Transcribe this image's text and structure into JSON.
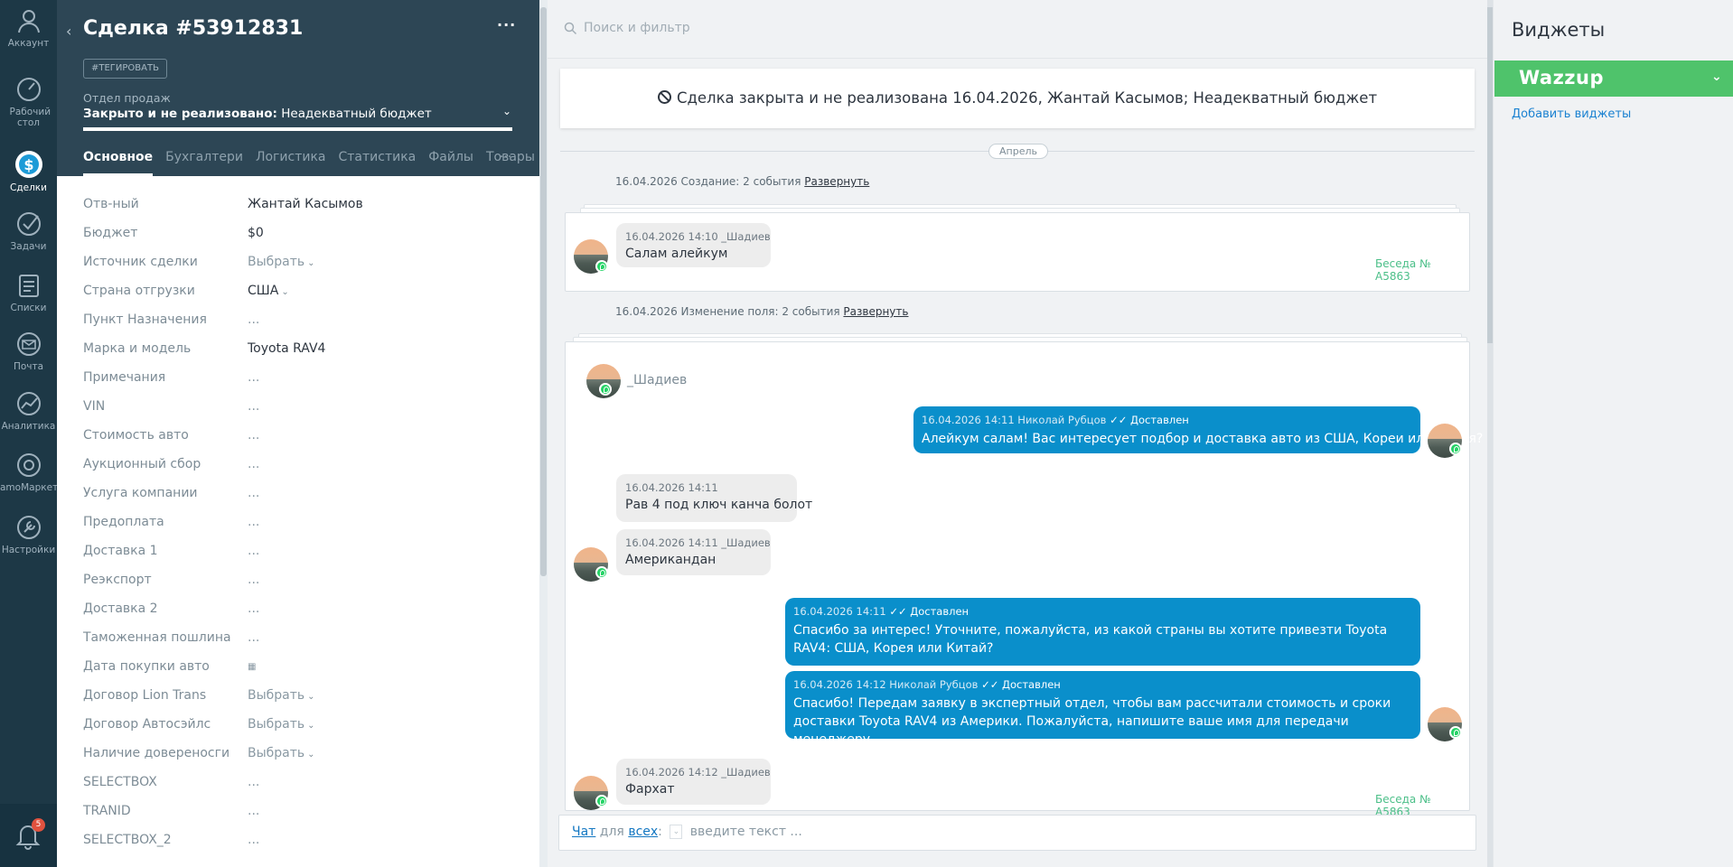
{
  "nav": {
    "account": "Аккаунт",
    "dashboard": "Рабочий стол",
    "deals": "Сделки",
    "tasks": "Задачи",
    "lists": "Списки",
    "mail": "Почта",
    "analytics": "Аналитика",
    "market": "amoМаркет",
    "settings": "Настройки",
    "notifications_count": "5"
  },
  "card": {
    "title": "Сделка #53912831",
    "tag_button": "#ТЕГИРОВАТЬ",
    "pipeline_label": "Отдел продаж",
    "status_prefix": "Закрыто и не реализовано:",
    "status_reason": "Неадекватный бюджет",
    "more": "···",
    "tabs": [
      "Основное",
      "Бухгалтери",
      "Логистика",
      "Статистика",
      "Файлы",
      "Товары"
    ],
    "tabs_more": "···",
    "fields": [
      {
        "label": "Отв-ный",
        "value": "Жантай Касымов"
      },
      {
        "label": "Бюджет",
        "value": "$0"
      },
      {
        "label": "Источник сделки",
        "value": "Выбрать"
      },
      {
        "label": "Страна отгрузки",
        "value": "США"
      },
      {
        "label": "Пункт Назначения",
        "value": "..."
      },
      {
        "label": "Марка и модель",
        "value": "Toyota RAV4"
      },
      {
        "label": "Примечания",
        "value": "..."
      },
      {
        "label": "VIN",
        "value": "..."
      },
      {
        "label": "Стоимость авто",
        "value": "..."
      },
      {
        "label": "Аукционный сбор",
        "value": "..."
      },
      {
        "label": "Услуга компании",
        "value": "..."
      },
      {
        "label": "Предоплата",
        "value": "..."
      },
      {
        "label": "Доставка 1",
        "value": "..."
      },
      {
        "label": "Реэкспорт",
        "value": "..."
      },
      {
        "label": "Доставка 2",
        "value": "..."
      },
      {
        "label": "Таможенная пошлина",
        "value": "..."
      },
      {
        "label": "Дата покупки авто",
        "value": ""
      },
      {
        "label": "Договор Lion Trans",
        "value": "Выбрать"
      },
      {
        "label": "Договор Автосэйлс",
        "value": "Выбрать"
      },
      {
        "label": "Наличие довереносги",
        "value": "Выбрать"
      },
      {
        "label": "SELECTBOX",
        "value": "..."
      },
      {
        "label": "TRANID",
        "value": "..."
      },
      {
        "label": "SELECTBOX_2",
        "value": "..."
      }
    ]
  },
  "feed": {
    "search_placeholder": "Поиск и фильтр",
    "closed_banner": "Сделка закрыта и не реализована 16.04.2026, Жантай Касымов; Неадекватный бюджет",
    "month": "Апрель",
    "event1": "16.04.2026 Создание: 2 события",
    "event2": "16.04.2026 Изменение поля: 2 события",
    "expand": "Развернуть",
    "chat_link": "Беседа № A5863",
    "sender": "_Шадиев",
    "messages": [
      {
        "meta": "16.04.2026 14:10 _Шадиев",
        "text": "Салам алейкум"
      },
      {
        "meta": "16.04.2026 14:11 Николай Рубцов",
        "status": "Доставлен",
        "text": "Алейкум салам! Вас интересует подбор и доставка авто из США, Кореи или Китая?"
      },
      {
        "meta": "16.04.2026 14:11",
        "text": "Рав 4 под ключ канча болот"
      },
      {
        "meta": "16.04.2026 14:11 _Шадиев",
        "text": "Американдан"
      },
      {
        "meta": "16.04.2026 14:11",
        "status": "Доставлен",
        "text": "Спасибо за интерес! Уточните, пожалуйста, из какой страны вы хотите привезти Toyota RAV4: США, Корея или Китай?"
      },
      {
        "meta": "16.04.2026 14:12 Николай Рубцов",
        "status": "Доставлен",
        "text": "Спасибо! Передам заявку в экспертный отдел, чтобы вам рассчитали стоимость и сроки доставки Toyota RAV4 из Америки. Пожалуйста, напишите ваше имя для передачи менеджеру."
      },
      {
        "meta": "16.04.2026 14:12 _Шадиев",
        "text": "Фархат"
      }
    ],
    "composer": {
      "chat": "Чат",
      "for": "для",
      "all": "всех",
      "placeholder": "введите текст ..."
    }
  },
  "widgets": {
    "title": "Виджеты",
    "wazzup": "Wazzup",
    "add": "Добавить виджеты"
  },
  "colors": {
    "nav_bg": "#1d3846",
    "card_header": "#2d4655",
    "outgoing_bubble": "#0a8fcb",
    "wazzup_green": "#4fc36b",
    "link_blue": "#1b82d1"
  }
}
